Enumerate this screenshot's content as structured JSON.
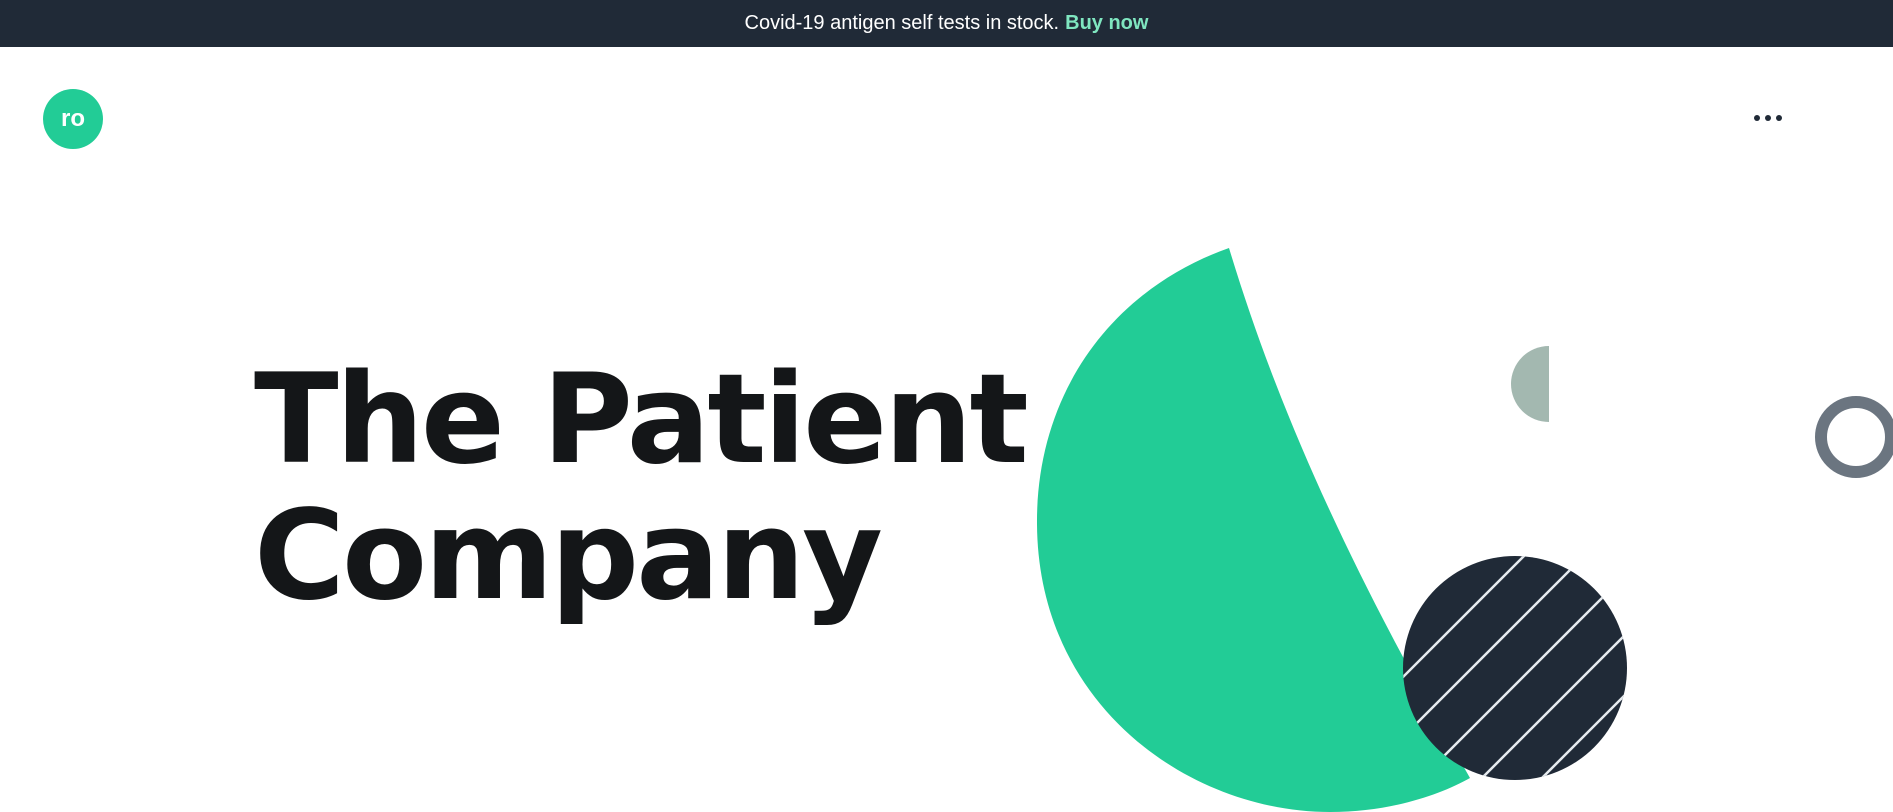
{
  "banner": {
    "message": "Covid-19 antigen self tests in stock.",
    "link_label": "Buy now"
  },
  "header": {
    "logo_text": "ro",
    "menu_icon": "more-horizontal-icon"
  },
  "hero": {
    "title_line_1": "The Patient",
    "title_line_2": "Company"
  },
  "colors": {
    "brand_green": "#22cc96",
    "navy": "#202a37",
    "link_mint": "#7fe6c0",
    "sage": "#a3b8b0",
    "gray_ring": "#6b7580",
    "headline": "#141618"
  }
}
